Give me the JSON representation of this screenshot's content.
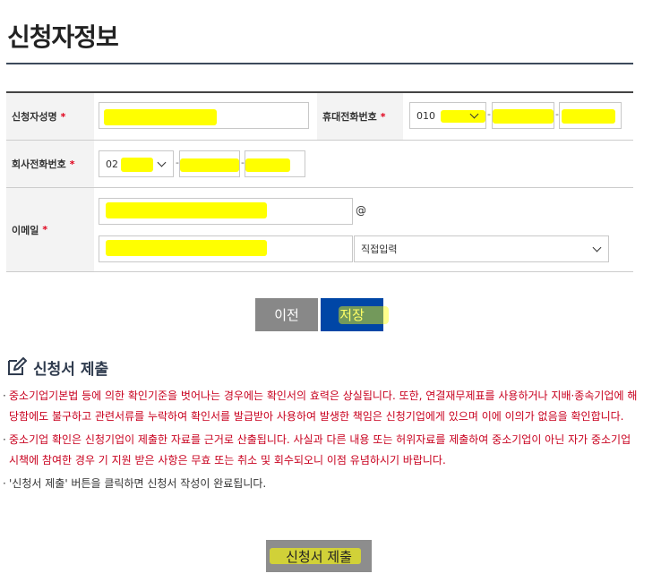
{
  "page": {
    "title": "신청자정보"
  },
  "form": {
    "required_mark": "*",
    "applicant_name": {
      "label": "신청자성명"
    },
    "mobile": {
      "label": "휴대전화번호",
      "prefix_selected": "010",
      "separator": "-"
    },
    "company_phone": {
      "label": "회사전화번호",
      "area_selected": "02",
      "separator": "-"
    },
    "email": {
      "label": "이메일",
      "at_symbol": "@",
      "domain_selected": "직접입력"
    }
  },
  "buttons": {
    "prev_label": "이전",
    "save_label": "저장"
  },
  "submit_section": {
    "title": "신청서 제출",
    "notices": [
      {
        "bullet": "·",
        "red": "중소기업기본법 등에 의한 확인기준을 벗어나는 경우에는 확인서의 효력은 상실됩니다. 또한, 연결재무제표를 사용하거나 지배·종속기업에 해당함에도 불구하고 관련서류를 누락하여 확인서를 발급받아 사용하여 발생한 책임은 신청기업에게 있으며 이에 이의가 없음을 확인합니다.",
        "black": ""
      },
      {
        "bullet": "·",
        "red": "중소기업 확인은 신청기업이 제출한 자료를 근거로 산출됩니다. 사실과 다른 내용 또는 허위자료를 제출하여 중소기업이 아닌 자가 중소기업 시책에 참여한 경우 기 지원 받은 사항은 무효 또는 취소 및 회수되오니 이점 유념하시기 바랍니다.",
        "black": ""
      },
      {
        "bullet": "·",
        "red": "",
        "black": "'신청서 제출' 버튼을 클릭하면 신청서 작성이 완료됩니다."
      }
    ],
    "submit_label": "신청서 제출"
  },
  "colors": {
    "primary": "#0046a6",
    "required": "#e0001a",
    "notice_red": "#c8001e",
    "highlight": "#ffff00"
  },
  "icons": {
    "section": "edit-icon",
    "dropdown": "chevron-down-icon"
  }
}
